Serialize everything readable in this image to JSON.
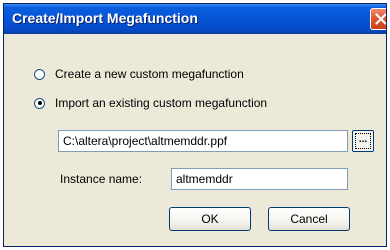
{
  "window": {
    "title": "Create/Import Megafunction"
  },
  "options": {
    "create_label": "Create a new custom megafunction",
    "create_selected": false,
    "import_label": "Import an existing custom megafunction",
    "import_selected": true
  },
  "file": {
    "path_value": "C:\\altera\\project\\altmemddr.ppf",
    "browse_label": "..."
  },
  "instance": {
    "label": "Instance name:",
    "value": "altmemddr"
  },
  "buttons": {
    "ok_label": "OK",
    "cancel_label": "Cancel"
  },
  "colors": {
    "titlebar": "#0654d6",
    "dialog_background": "#ece9d8",
    "close_button": "#e0532c"
  }
}
